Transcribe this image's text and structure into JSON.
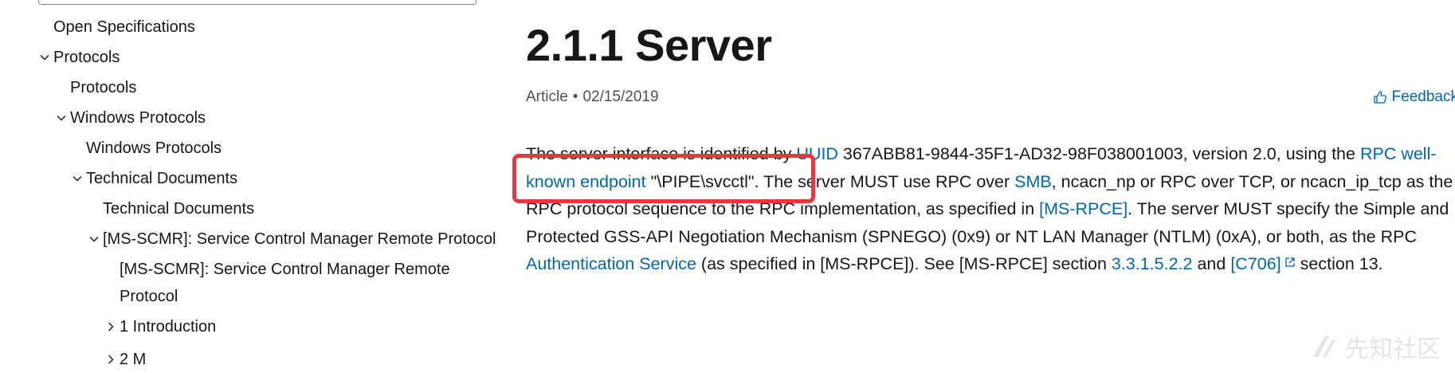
{
  "sidebar": {
    "items": [
      {
        "label": "Open Specifications",
        "chevron": "none"
      },
      {
        "label": "Protocols",
        "chevron": "down"
      },
      {
        "label": "Protocols",
        "chevron": "none"
      },
      {
        "label": "Windows Protocols",
        "chevron": "down"
      },
      {
        "label": "Windows Protocols",
        "chevron": "none"
      },
      {
        "label": "Technical Documents",
        "chevron": "down"
      },
      {
        "label": "Technical Documents",
        "chevron": "none"
      },
      {
        "label": "[MS-SCMR]: Service Control Manager Remote Protocol",
        "chevron": "down"
      },
      {
        "label": "[MS-SCMR]: Service Control Manager Remote Protocol",
        "chevron": "none"
      },
      {
        "label": "1 Introduction",
        "chevron": "right"
      },
      {
        "label": "2 M",
        "chevron": "right"
      }
    ]
  },
  "article": {
    "title": "2.1.1 Server",
    "type": "Article",
    "date": "02/15/2019",
    "feedback_label": "Feedback",
    "p1": "The server interface is identified by ",
    "uuid_link": "UUID",
    "p2": " 367ABB81-9844-35F1-AD32-98F038001003, version 2.0, using the ",
    "endpoint_link": "RPC well-known endpoint",
    "p3": " \"\\PIPE\\svcctl\". The server MUST use RPC over ",
    "smb_link": "SMB",
    "p4": ", ncacn_np or RPC over TCP, or ncacn_ip_tcp as the RPC protocol sequence to the RPC implementation, as specified in ",
    "rpce_link": "[MS-RPCE]",
    "p5": ". The server MUST specify the Simple and Protected GSS-API Negotiation Mechanism (SPNEGO) (0x9) or NT LAN Manager (NTLM) (0xA), or both, as the RPC ",
    "auth_link": "Authentication Service",
    "p6": " (as specified in [MS-RPCE]). See [MS-RPCE] section ",
    "section_link": "3.3.1.5.2.2",
    "p7": " and ",
    "c706_link": "[C706]",
    "p8": " section 13."
  },
  "watermark": {
    "text": "先知社区"
  },
  "colors": {
    "link": "#0065b3",
    "annotation": "#e8383d",
    "text": "#171717",
    "meta": "#505050"
  }
}
